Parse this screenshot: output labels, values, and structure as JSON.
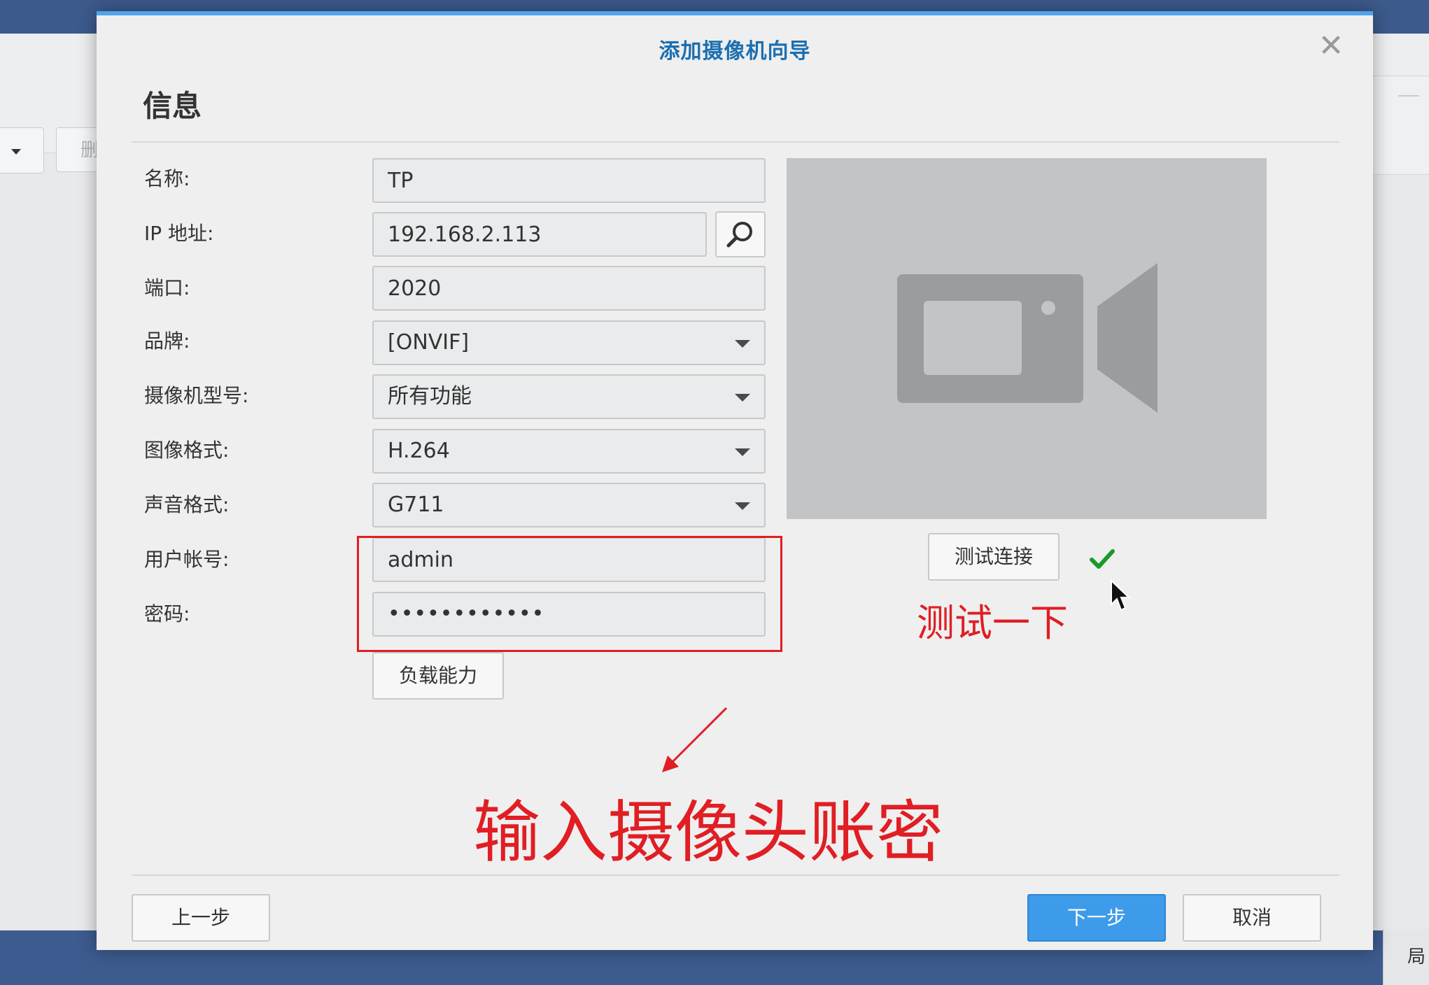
{
  "window": {
    "title": "添加摄像机向导",
    "section_title": "信息"
  },
  "background": {
    "toolbar_button_label": "删",
    "corner_button_label": "局"
  },
  "form": {
    "fields": [
      {
        "label": "名称:",
        "value": "TP",
        "type": "text"
      },
      {
        "label": "IP 地址:",
        "value": "192.168.2.113",
        "type": "text"
      },
      {
        "label": "端口:",
        "value": "2020",
        "type": "text"
      },
      {
        "label": "品牌:",
        "value": "[ONVIF]",
        "type": "select"
      },
      {
        "label": "摄像机型号:",
        "value": "所有功能",
        "type": "select"
      },
      {
        "label": "图像格式:",
        "value": "H.264",
        "type": "select"
      },
      {
        "label": "声音格式:",
        "value": "G711",
        "type": "select"
      },
      {
        "label": "用户帐号:",
        "value": "admin",
        "type": "text"
      },
      {
        "label": "密码:",
        "value": "••••••••••••",
        "type": "password"
      }
    ],
    "capability_button": "负载能力"
  },
  "preview": {
    "icon": "video-camera-icon",
    "test_button": "测试连接",
    "test_status_icon": "checkmark-icon",
    "test_status_color": "#1a9a2b"
  },
  "annotations": {
    "test_note": "测试一下",
    "credentials_note": "输入摄像头账密",
    "color": "#e01e24"
  },
  "footer": {
    "prev_button": "上一步",
    "next_button": "下一步",
    "cancel_button": "取消"
  },
  "colors": {
    "accent": "#3e9be9",
    "title": "#1b6fb0",
    "dialog_top_border": "#4fa5ec"
  }
}
